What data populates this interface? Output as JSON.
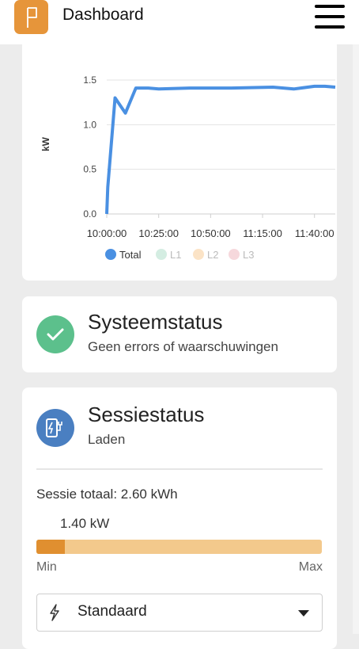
{
  "header": {
    "title": "Dashboard"
  },
  "chart_data": {
    "type": "line",
    "ylabel": "kW",
    "ylim": [
      0,
      1.5
    ],
    "yticks": [
      "0.0",
      "0.5",
      "1.0",
      "1.5"
    ],
    "xticks": [
      "10:00:00",
      "10:25:00",
      "10:50:00",
      "11:15:00",
      "11:40:00"
    ],
    "xtick_minutes": [
      0,
      25,
      50,
      75,
      100
    ],
    "xlim_minutes": [
      0,
      110
    ],
    "legend_position": "bottom",
    "series": [
      {
        "name": "Total",
        "color": "#4a90e2",
        "active": true,
        "x": [
          0,
          0.5,
          4,
          9,
          14,
          20,
          25,
          40,
          60,
          80,
          90,
          100,
          105,
          110
        ],
        "y": [
          0.0,
          0.3,
          1.3,
          1.13,
          1.41,
          1.41,
          1.4,
          1.41,
          1.41,
          1.42,
          1.4,
          1.43,
          1.43,
          1.42
        ]
      },
      {
        "name": "L1",
        "color": "#d4ede2",
        "active": false,
        "x": [],
        "y": []
      },
      {
        "name": "L2",
        "color": "#fbe3c6",
        "active": false,
        "x": [],
        "y": []
      },
      {
        "name": "L3",
        "color": "#f6d8dc",
        "active": false,
        "x": [],
        "y": []
      }
    ]
  },
  "system_status": {
    "title": "Systeemstatus",
    "subtitle": "Geen errors of waarschuwingen",
    "icon": "check-icon",
    "color": "#5cc08c"
  },
  "session_status": {
    "title": "Sessiestatus",
    "subtitle": "Laden",
    "icon": "charging-station-icon",
    "color": "#4a7fc1",
    "total_label": "Sessie totaal:",
    "total_value": "2.60 kWh",
    "power_value": "1.40 kW",
    "progress_fraction": 0.1,
    "min_label": "Min",
    "max_label": "Max",
    "mode_selected": "Standaard"
  }
}
